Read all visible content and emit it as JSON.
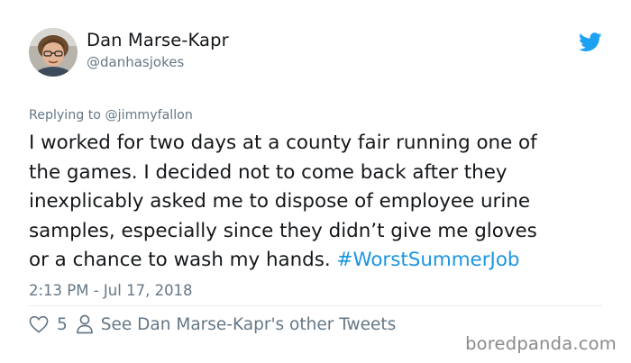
{
  "tweet": {
    "author_name": "Dan Marse-Kapr",
    "author_handle": "@danhasjokes",
    "replying_to": "Replying to @jimmyfallon",
    "body_lines": [
      "I worked for two days at a county fair running one of",
      "the games. I decided not to come back after they",
      "inexplicably asked me to dispose of employee urine",
      "samples, especially since they didn’t give me gloves",
      "or a chance to wash my hands. "
    ],
    "hashtag": "#WorstSummerJob",
    "timestamp": "2:13 PM - Jul 17, 2018",
    "like_count": "5",
    "other_tweets_link": "See Dan Marse-Kapr's other Tweets",
    "icons": {
      "avatar": "avatar-photo",
      "platform": "twitter-bird-icon",
      "like": "heart-icon",
      "profile": "person-icon"
    }
  },
  "watermark": "boredpanda.com",
  "colors": {
    "text": "#14171a",
    "secondary": "#657786",
    "link": "#1b95e0",
    "brand": "#1da1f2"
  }
}
